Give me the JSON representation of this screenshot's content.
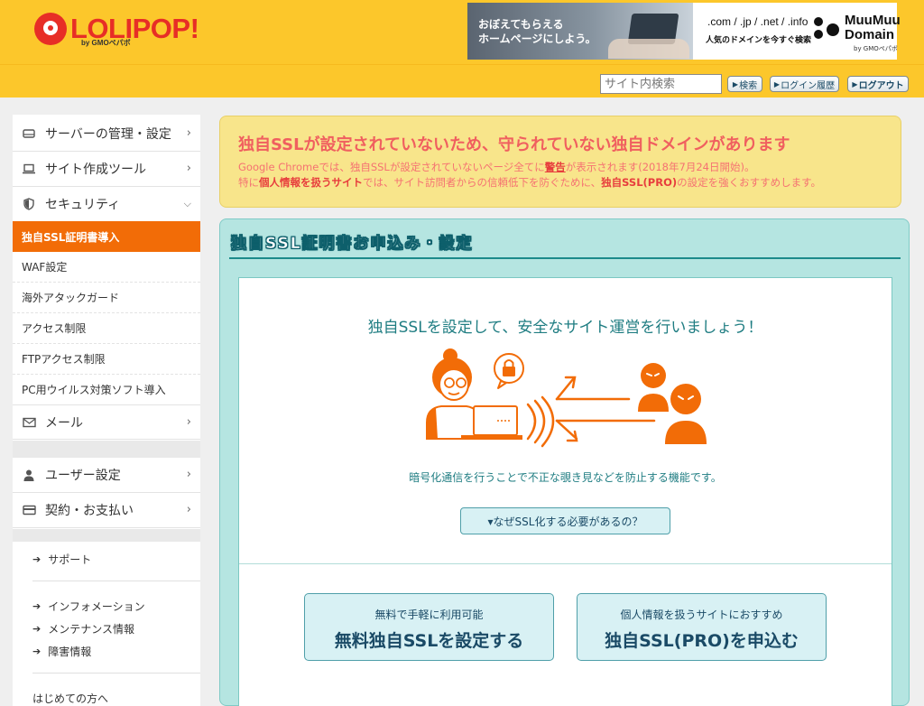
{
  "header": {
    "logo_text": "LOLIPOP!",
    "logo_sub": "by GMOペパボ",
    "banner": {
      "left_text_line1": "おぼえてもらえる",
      "left_text_line2": "ホームページにしよう。",
      "domains": ".com / .jp / .net / .info",
      "domains_sub": "人気のドメインを今すぐ検索",
      "brand_line1": "MuuMuu",
      "brand_line2": "Domain",
      "brand_sub": "by GMOペパボ"
    },
    "search_placeholder": "サイト内検索",
    "search_button": "検索",
    "history_button": "ログイン履歴",
    "logout_button": "ログアウト"
  },
  "sidebar": {
    "server": "サーバーの管理・設定",
    "site_tool": "サイト作成ツール",
    "security": "セキュリティ",
    "security_items": [
      "独自SSL証明書導入",
      "WAF設定",
      "海外アタックガード",
      "アクセス制限",
      "FTPアクセス制限",
      "PC用ウイルス対策ソフト導入"
    ],
    "mail": "メール",
    "user_settings": "ユーザー設定",
    "contract": "契約・お支払い",
    "support": "サポート",
    "information": "インフォメーション",
    "maintenance": "メンテナンス情報",
    "trouble": "障害情報",
    "beginners": "はじめての方へ"
  },
  "warning": {
    "title": "独自SSLが設定されていないため、守られていない独自ドメインがあります",
    "line1_a": "Google Chromeでは、独自SSLが設定されていないページ全てに",
    "line1_b": "警告",
    "line1_c": "が表示されます(2018年7月24日開始)。",
    "line2_a": "特に",
    "line2_b": "個人情報を扱うサイト",
    "line2_c": "では、サイト訪問者からの信頼低下を防ぐために、",
    "line2_d": "独自SSL(PRO)",
    "line2_e": "の設定を強くおすすめします。"
  },
  "main": {
    "panel_title": "独自SSL証明書お申込み・設定",
    "headline": "独自SSLを設定して、安全なサイト運営を行いましょう！",
    "description": "暗号化通信を行うことで不正な覗き見などを防止する機能です。",
    "why_button": "▾なぜSSL化する必要があるの？",
    "free_small": "無料で手軽に利用可能",
    "free_main": "無料独自SSLを設定する",
    "pro_small": "個人情報を扱うサイトにおすすめ",
    "pro_main": "独自SSL(PRO)を申込む"
  },
  "colors": {
    "header_bg": "#fcc72b",
    "accent_orange": "#f26c07",
    "warning_bg": "#f8e58b",
    "warning_text": "#f05f5f",
    "panel_bg": "#b5e5e1",
    "teal_text": "#1f7d82"
  },
  "icons": [
    "server-icon",
    "laptop-icon",
    "shield-icon",
    "mail-icon",
    "user-icon",
    "card-icon",
    "arrow-right-icon",
    "chevron-right-icon",
    "chevron-down-icon",
    "lock-icon"
  ]
}
